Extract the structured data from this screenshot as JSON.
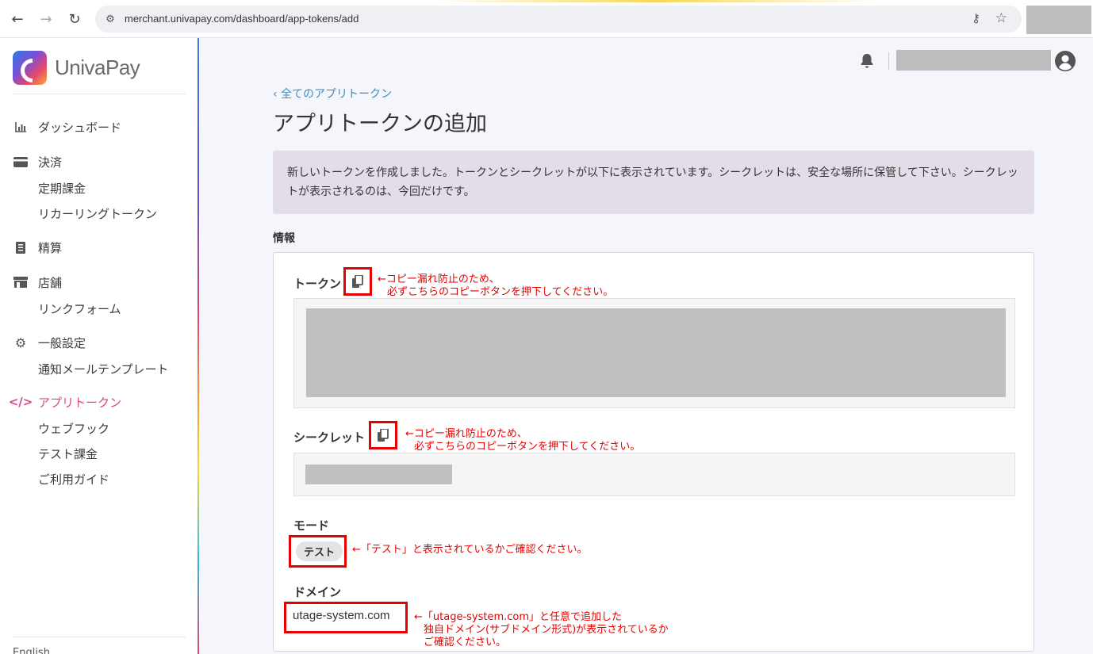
{
  "browser": {
    "url": "merchant.univapay.com/dashboard/app-tokens/add"
  },
  "sidebar": {
    "brand": "UnivaPay",
    "items": [
      {
        "label": "ダッシュボード",
        "icon": "bar-chart-icon"
      },
      {
        "label": "決済",
        "icon": "credit-card-icon"
      },
      {
        "label": "定期課金"
      },
      {
        "label": "リカーリングトークン"
      },
      {
        "label": "精算",
        "icon": "receipt-icon"
      },
      {
        "label": "店舗",
        "icon": "store-icon"
      },
      {
        "label": "リンクフォーム"
      },
      {
        "label": "一般設定",
        "icon": "gear-icon"
      },
      {
        "label": "通知メールテンプレート"
      },
      {
        "label": "アプリトークン",
        "icon": "code-icon",
        "active": true
      },
      {
        "label": "ウェブフック"
      },
      {
        "label": "テスト課金"
      },
      {
        "label": "ご利用ガイド"
      }
    ],
    "language": "English",
    "active_color": "#d6478a"
  },
  "main": {
    "back_link": "‹ 全てのアプリトークン",
    "title": "アプリトークンの追加",
    "notice": "新しいトークンを作成しました。トークンとシークレットが以下に表示されています。シークレットは、安全な場所に保管して下さい。シークレットが表示されるのは、今回だけです。",
    "section_label": "情報",
    "fields": {
      "token_label": "トークン",
      "secret_label": "シークレット",
      "mode_label": "モード",
      "mode_value": "テスト",
      "domain_label": "ドメイン",
      "domain_value": "utage-system.com"
    }
  },
  "annotations": {
    "token_line1": "←コピー漏れ防止のため、",
    "token_line2": "必ずこちらのコピーボタンを押下してください。",
    "secret_line1": "←コピー漏れ防止のため、",
    "secret_line2": "必ずこちらのコピーボタンを押下してください。",
    "mode": "←「テスト」と表示されているかご確認ください。",
    "domain_line1": "←「utage-system.com」と任意で追加した",
    "domain_line2": "独自ドメイン(サブドメイン形式)が表示されているか",
    "domain_line3": "ご確認ください。",
    "color": "#e60000"
  }
}
